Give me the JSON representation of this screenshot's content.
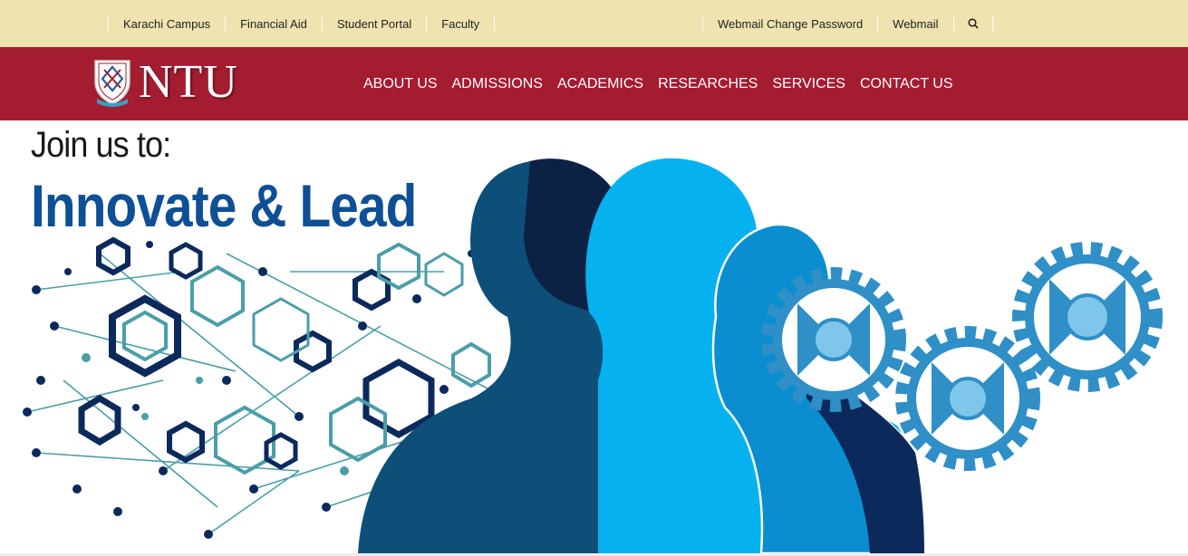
{
  "top_links_left": [
    "Karachi Campus",
    "Financial Aid",
    "Student Portal",
    "Faculty"
  ],
  "top_links_right": [
    "Webmail Change Password",
    "Webmail"
  ],
  "search_icon": "search-icon",
  "brand": {
    "name": "NTU",
    "logo": "ntu-crest-logo",
    "tagline": "INNOVATE AND LEAD"
  },
  "nav": [
    "ABOUT US",
    "ADMISSIONS",
    "ACADEMICS",
    "RESEARCHES",
    "SERVICES",
    "CONTACT US"
  ],
  "hero": {
    "line1": "Join us to:",
    "line2": "Innovate & Lead"
  },
  "colors": {
    "topbar": "#efe4b0",
    "nav": "#a31c30",
    "heading_blue": "#0e4f95",
    "navy": "#0b2a5b",
    "teal": "#4b9ea7",
    "sky": "#0aa7e6",
    "gear": "#2f8fc6"
  }
}
